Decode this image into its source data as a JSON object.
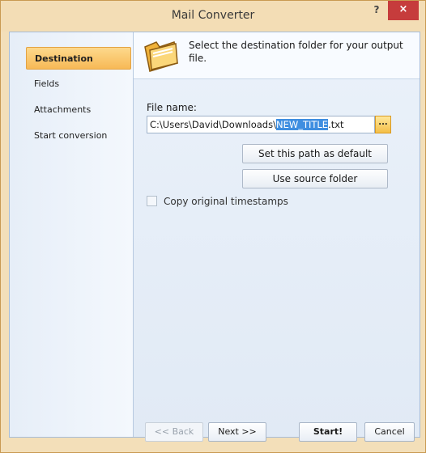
{
  "window": {
    "title": "Mail Converter",
    "help_label": "?",
    "close_label": "×"
  },
  "sidebar": {
    "items": [
      {
        "label": "Destination",
        "active": true
      },
      {
        "label": "Fields",
        "active": false
      },
      {
        "label": "Attachments",
        "active": false
      },
      {
        "label": "Start conversion",
        "active": false
      }
    ]
  },
  "main": {
    "header_text": "Select the destination folder for your output file.",
    "file_name_label": "File name:",
    "path_prefix": "C:\\Users\\David\\Downloads\\",
    "path_selected": "NEW_TITLE",
    "path_suffix": ".txt",
    "browse_label": "...",
    "set_default_label": "Set this path as default",
    "use_source_label": "Use source folder",
    "copy_timestamps_label": "Copy original timestamps",
    "copy_timestamps_checked": false
  },
  "footer": {
    "back_label": "<< Back",
    "next_label": "Next >>",
    "start_label": "Start!",
    "cancel_label": "Cancel"
  },
  "colors": {
    "accent": "#f7b956",
    "selection": "#3f8ee0",
    "close": "#c63c3c"
  }
}
